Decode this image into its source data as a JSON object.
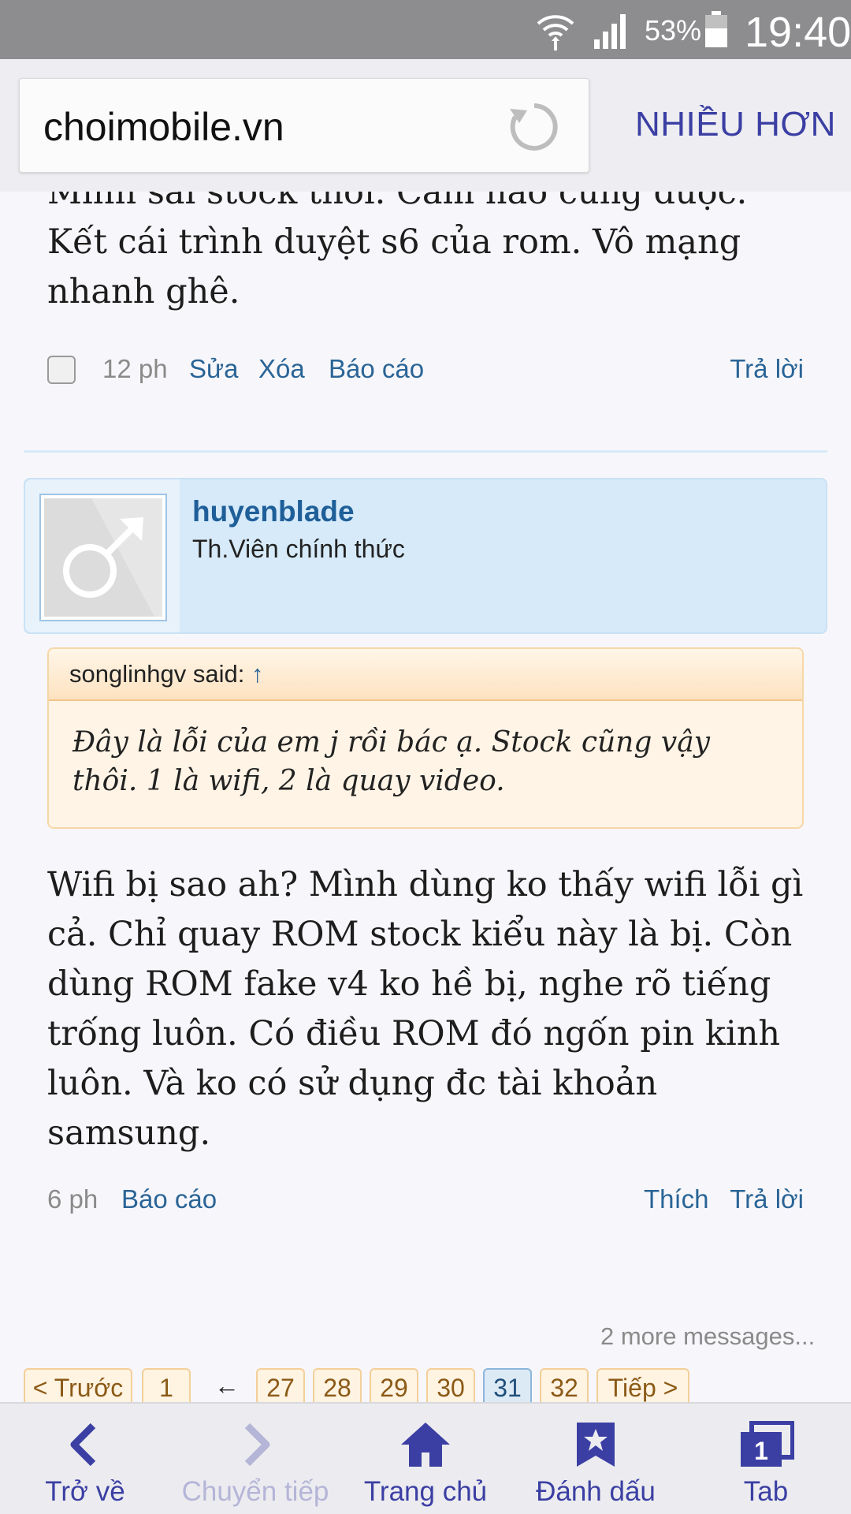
{
  "status_bar": {
    "battery_percent": "53%",
    "time": "19:40"
  },
  "browser": {
    "url": "choimobile.vn",
    "more_label": "NHIỀU HƠN"
  },
  "post1": {
    "text": "Mình sài stock thôi. Cảm nào cũng được. Kết cái trình duyệt s6 của rom. Vô mạng nhanh ghê.",
    "time": "12 ph",
    "edit_label": "Sửa",
    "delete_label": "Xóa",
    "report_label": "Báo cáo",
    "reply_label": "Trả lời"
  },
  "post2": {
    "username": "huyenblade",
    "user_title": "Th.Viên chính thức",
    "quote_author": "songlinhgv said:",
    "quote_arrow": "↑",
    "quote_text": "Đây là lỗi của em j rồi bác ạ. Stock cũng vậy thôi. 1 là wifi, 2 là quay video.",
    "text": "Wifi bị sao ah? Mình dùng ko thấy wifi lỗi gì cả. Chỉ quay ROM stock kiểu này là bị. Còn dùng ROM fake v4 ko hề bị, nghe rõ tiếng trống luôn. Có điều ROM đó ngốn pin kinh luôn. Và ko có sử dụng đc tài khoản samsung.",
    "time": "6 ph",
    "report_label": "Báo cáo",
    "like_label": "Thích",
    "reply_label": "Trả lời"
  },
  "more_messages": "2 more messages...",
  "pagination": {
    "prev": "< Trước",
    "first": "1",
    "skip": "←",
    "pages": [
      "27",
      "28",
      "29",
      "30",
      "31",
      "32"
    ],
    "current": "31",
    "next": "Tiếp >"
  },
  "bottom_nav": [
    {
      "label": "Trở về",
      "icon": "back-icon"
    },
    {
      "label": "Chuyển tiếp",
      "icon": "forward-icon"
    },
    {
      "label": "Trang chủ",
      "icon": "home-icon"
    },
    {
      "label": "Đánh dấu",
      "icon": "bookmark-icon"
    },
    {
      "label": "Tab",
      "icon": "tabs-icon",
      "badge": "1"
    }
  ],
  "colors": {
    "accent": "#3b3fa3",
    "link": "#2a6496",
    "status_bar": "#8d8d8f"
  }
}
